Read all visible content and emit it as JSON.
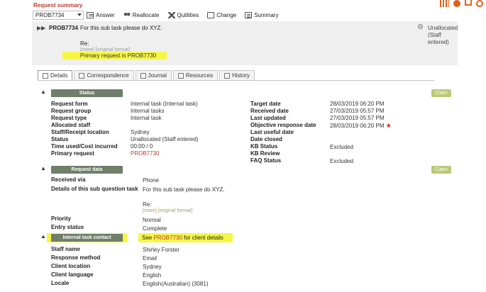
{
  "header": {
    "title": "Request summary"
  },
  "select": {
    "value": "PROB7734"
  },
  "toolbar": {
    "answer": "Answer",
    "reallocate": "Reallocate",
    "qutilities": "Qutilities",
    "change": "Change",
    "summary": "Summary"
  },
  "summary": {
    "id": "PROB7734",
    "subject": "For this sub task please do XYZ.",
    "re": "Re:",
    "more": "[more]",
    "original": "[original format]",
    "highlight": "Primary request is PROB7730",
    "alloc_status": "Unallocated (Staff entered)"
  },
  "tabs": [
    "Details",
    "Correspondence",
    "Journal",
    "Resources",
    "History"
  ],
  "status_section": {
    "title": "Status",
    "claim": "Claim",
    "left_labels": [
      "Request form",
      "Request group",
      "Request type",
      "Allocated staff",
      "Staff/Receipt location",
      "Status",
      "Time used/Cost incurred",
      "Primary request"
    ],
    "left_values": [
      "Internal task (Internal task)",
      "Internal tasks",
      "Internal task",
      "",
      "Sydney",
      "Unallocated (Staff entered)",
      "00:00 / 0",
      "PROB7730"
    ],
    "right_labels": [
      "Target date",
      "Received date",
      "Last updated",
      "Objective response date",
      "Last useful date",
      "Date closed",
      "KB Status",
      "KB Review",
      "FAQ Status"
    ],
    "right_values": [
      "28/03/2019 06:20 PM",
      "27/03/2019 05:57 PM",
      "27/03/2019 05:57 PM",
      "28/03/2019 06:20 PM",
      "",
      "",
      "Excluded",
      "",
      "Excluded"
    ]
  },
  "request_section": {
    "title": "Request data",
    "claim": "Claim",
    "received_via_label": "Received via",
    "received_via": "Phone",
    "details_label": "Details of this sub question task",
    "details": "For this sub task please do XYZ.",
    "re": "Re:",
    "more": "[more]",
    "original": "[original format]",
    "priority_label": "Priority",
    "priority": "Normal",
    "entry_label": "Entry status",
    "entry": "Complete"
  },
  "contact_section": {
    "title": "Internal task contact",
    "see_prefix": "See",
    "see_link": "PROB7730",
    "see_suffix": "for client details",
    "labels": [
      "Staff name",
      "Response method",
      "Client location",
      "Client language",
      "Locale"
    ],
    "values": [
      "Shirley Forster",
      "Email",
      "Sydney",
      "English",
      "English(Australian) (3081)"
    ]
  }
}
